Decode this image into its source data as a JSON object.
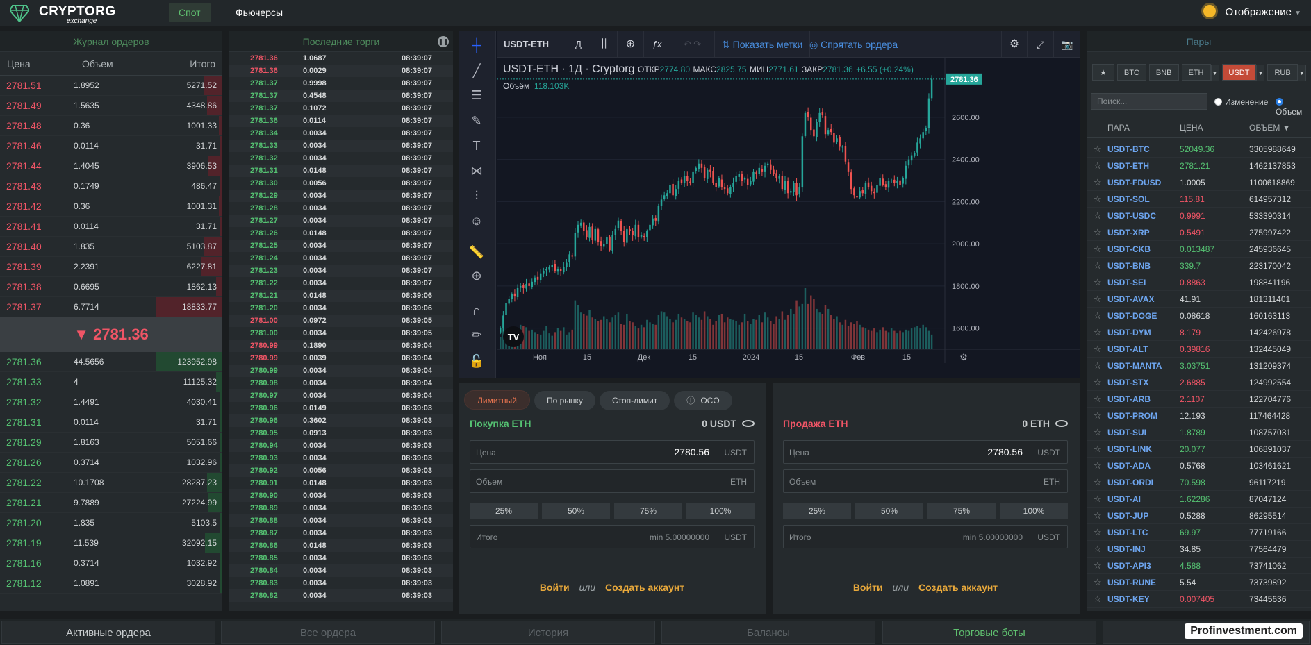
{
  "brand": {
    "name": "CRYPTORG",
    "sub": "exchange"
  },
  "nav": {
    "spot": "Спот",
    "futures": "Фьючерсы",
    "display": "Отображение"
  },
  "orderbook": {
    "title": "Журнал ордеров",
    "cols": [
      "Цена",
      "Объем",
      "Итого"
    ],
    "asks": [
      [
        "2781.51",
        "1.8952",
        "5271.52"
      ],
      [
        "2781.49",
        "1.5635",
        "4348.86"
      ],
      [
        "2781.48",
        "0.36",
        "1001.33"
      ],
      [
        "2781.46",
        "0.0114",
        "31.71"
      ],
      [
        "2781.44",
        "1.4045",
        "3906.53"
      ],
      [
        "2781.43",
        "0.1749",
        "486.47"
      ],
      [
        "2781.42",
        "0.36",
        "1001.31"
      ],
      [
        "2781.41",
        "0.0114",
        "31.71"
      ],
      [
        "2781.40",
        "1.835",
        "5103.87"
      ],
      [
        "2781.39",
        "2.2391",
        "6227.81"
      ],
      [
        "2781.38",
        "0.6695",
        "1862.13"
      ],
      [
        "2781.37",
        "6.7714",
        "18833.77"
      ]
    ],
    "mid": "▼ 2781.36",
    "bids": [
      [
        "2781.36",
        "44.5656",
        "123952.98"
      ],
      [
        "2781.33",
        "4",
        "11125.32"
      ],
      [
        "2781.32",
        "1.4491",
        "4030.41"
      ],
      [
        "2781.31",
        "0.0114",
        "31.71"
      ],
      [
        "2781.29",
        "1.8163",
        "5051.66"
      ],
      [
        "2781.26",
        "0.3714",
        "1032.96"
      ],
      [
        "2781.22",
        "10.1708",
        "28287.23"
      ],
      [
        "2781.21",
        "9.7889",
        "27224.99"
      ],
      [
        "2781.20",
        "1.835",
        "5103.5"
      ],
      [
        "2781.19",
        "11.539",
        "32092.15"
      ],
      [
        "2781.16",
        "0.3714",
        "1032.92"
      ],
      [
        "2781.12",
        "1.0891",
        "3028.92"
      ]
    ]
  },
  "trades": {
    "title": "Последние торги",
    "rows": [
      [
        "2781.36",
        "1.0687",
        "08:39:07",
        "r"
      ],
      [
        "2781.36",
        "0.0029",
        "08:39:07",
        "r"
      ],
      [
        "2781.37",
        "0.9998",
        "08:39:07",
        "g"
      ],
      [
        "2781.37",
        "0.4548",
        "08:39:07",
        "g"
      ],
      [
        "2781.37",
        "0.1072",
        "08:39:07",
        "g"
      ],
      [
        "2781.36",
        "0.0114",
        "08:39:07",
        "g"
      ],
      [
        "2781.34",
        "0.0034",
        "08:39:07",
        "g"
      ],
      [
        "2781.33",
        "0.0034",
        "08:39:07",
        "g"
      ],
      [
        "2781.32",
        "0.0034",
        "08:39:07",
        "g"
      ],
      [
        "2781.31",
        "0.0148",
        "08:39:07",
        "g"
      ],
      [
        "2781.30",
        "0.0056",
        "08:39:07",
        "g"
      ],
      [
        "2781.29",
        "0.0034",
        "08:39:07",
        "g"
      ],
      [
        "2781.28",
        "0.0034",
        "08:39:07",
        "g"
      ],
      [
        "2781.27",
        "0.0034",
        "08:39:07",
        "g"
      ],
      [
        "2781.26",
        "0.0148",
        "08:39:07",
        "g"
      ],
      [
        "2781.25",
        "0.0034",
        "08:39:07",
        "g"
      ],
      [
        "2781.24",
        "0.0034",
        "08:39:07",
        "g"
      ],
      [
        "2781.23",
        "0.0034",
        "08:39:07",
        "g"
      ],
      [
        "2781.22",
        "0.0034",
        "08:39:07",
        "g"
      ],
      [
        "2781.21",
        "0.0148",
        "08:39:06",
        "g"
      ],
      [
        "2781.20",
        "0.0034",
        "08:39:06",
        "g"
      ],
      [
        "2781.00",
        "0.0972",
        "08:39:05",
        "r"
      ],
      [
        "2781.00",
        "0.0034",
        "08:39:05",
        "g"
      ],
      [
        "2780.99",
        "0.1890",
        "08:39:04",
        "r"
      ],
      [
        "2780.99",
        "0.0039",
        "08:39:04",
        "r"
      ],
      [
        "2780.99",
        "0.0034",
        "08:39:04",
        "g"
      ],
      [
        "2780.98",
        "0.0034",
        "08:39:04",
        "g"
      ],
      [
        "2780.97",
        "0.0034",
        "08:39:04",
        "g"
      ],
      [
        "2780.96",
        "0.0149",
        "08:39:03",
        "g"
      ],
      [
        "2780.96",
        "0.3602",
        "08:39:03",
        "g"
      ],
      [
        "2780.95",
        "0.0913",
        "08:39:03",
        "g"
      ],
      [
        "2780.94",
        "0.0034",
        "08:39:03",
        "g"
      ],
      [
        "2780.93",
        "0.0034",
        "08:39:03",
        "g"
      ],
      [
        "2780.92",
        "0.0056",
        "08:39:03",
        "g"
      ],
      [
        "2780.91",
        "0.0148",
        "08:39:03",
        "g"
      ],
      [
        "2780.90",
        "0.0034",
        "08:39:03",
        "g"
      ],
      [
        "2780.89",
        "0.0034",
        "08:39:03",
        "g"
      ],
      [
        "2780.88",
        "0.0034",
        "08:39:03",
        "g"
      ],
      [
        "2780.87",
        "0.0034",
        "08:39:03",
        "g"
      ],
      [
        "2780.86",
        "0.0148",
        "08:39:03",
        "g"
      ],
      [
        "2780.85",
        "0.0034",
        "08:39:03",
        "g"
      ],
      [
        "2780.84",
        "0.0034",
        "08:39:03",
        "g"
      ],
      [
        "2780.83",
        "0.0034",
        "08:39:03",
        "g"
      ],
      [
        "2780.82",
        "0.0034",
        "08:39:03",
        "g"
      ]
    ]
  },
  "chart": {
    "symbol": "USDT-ETH",
    "interval": "Д",
    "show_marks": "Показать метки",
    "hide_orders": "Спрятать ордера",
    "legend": {
      "name": "USDT-ETH · 1Д · Cryptorg",
      "open_l": "ОТКР",
      "open": "2774.80",
      "high_l": "МАКС",
      "high": "2825.75",
      "low_l": "МИН",
      "low": "2771.61",
      "close_l": "ЗАКР",
      "close": "2781.36",
      "change": "+6.55 (+0.24%)",
      "vol_l": "Объём",
      "vol": "118.103K"
    },
    "price_tag": "2781.36",
    "y_ticks": [
      "2600.00",
      "2400.00",
      "2200.00",
      "2000.00",
      "1800.00",
      "1600.00"
    ],
    "x_ticks": [
      "Ноя",
      "15",
      "Дек",
      "15",
      "2024",
      "15",
      "Фев",
      "15"
    ]
  },
  "chart_data": {
    "type": "candlestick",
    "ylim": [
      1500,
      2850
    ],
    "close": [
      1600,
      1660,
      1720,
      1740,
      1760,
      1750,
      1790,
      1800,
      1790,
      1810,
      1800,
      1820,
      1840,
      1830,
      1860,
      1870,
      1880,
      1890,
      1900,
      1870,
      1880,
      1870,
      1890,
      1910,
      1950,
      1940,
      2050,
      2090,
      2100,
      2060,
      2030,
      2080,
      2020,
      2070,
      2010,
      1990,
      2000,
      2030,
      1970,
      2040,
      2070,
      2110,
      2060,
      2010,
      2070,
      2060,
      2040,
      2090,
      2030,
      2040,
      2030,
      2060,
      2090,
      2120,
      2110,
      2180,
      2210,
      2230,
      2240,
      2280,
      2230,
      2260,
      2300,
      2290,
      2320,
      2300,
      2290,
      2340,
      2360,
      2380,
      2360,
      2310,
      2350,
      2340,
      2290,
      2270,
      2310,
      2270,
      2260,
      2240,
      2270,
      2290,
      2320,
      2330,
      2300,
      2310,
      2280,
      2300,
      2340,
      2330,
      2360,
      2340,
      2370,
      2380,
      2350,
      2330,
      2310,
      2320,
      2260,
      2300,
      2240,
      2250,
      2290,
      2230,
      2270,
      2510,
      2620,
      2600,
      2540,
      2510,
      2580,
      2620,
      2610,
      2520,
      2540,
      2530,
      2480,
      2500,
      2460,
      2460,
      2390,
      2340,
      2260,
      2230,
      2220,
      2250,
      2240,
      2290,
      2270,
      2250,
      2240,
      2280,
      2310,
      2280,
      2270,
      2300,
      2300,
      2290,
      2300,
      2280,
      2310,
      2370,
      2400,
      2420,
      2430,
      2480,
      2500,
      2530,
      2550,
      2690,
      2780
    ],
    "volumes": [
      20,
      35,
      30,
      28,
      25,
      22,
      34,
      40,
      38,
      36,
      30,
      32,
      28,
      25,
      24,
      30,
      38,
      26,
      22,
      28,
      35,
      30,
      36,
      24,
      28,
      32,
      80,
      72,
      60,
      58,
      55,
      64,
      52,
      50,
      46,
      48,
      54,
      50,
      44,
      52,
      56,
      60,
      42,
      40,
      58,
      46,
      44,
      38,
      34,
      40,
      36,
      48,
      44,
      42,
      40,
      56,
      62,
      60,
      54,
      50,
      44,
      48,
      58,
      52,
      50,
      46,
      44,
      60,
      56,
      52,
      48,
      62,
      54,
      50,
      40,
      46,
      56,
      58,
      44,
      52,
      50,
      48,
      46,
      40,
      44,
      58,
      46,
      42,
      50,
      48,
      56,
      44,
      60,
      52,
      46,
      42,
      54,
      50,
      62,
      48,
      56,
      66,
      58,
      80,
      70,
      74,
      100,
      74,
      88,
      82,
      66,
      60,
      58,
      72,
      66,
      56,
      50,
      54,
      44,
      40,
      48,
      38,
      44,
      42,
      46,
      40,
      36,
      34,
      32,
      30,
      34,
      28,
      32,
      36,
      30,
      28,
      34,
      30,
      26,
      30,
      28,
      32,
      30,
      34,
      36,
      38,
      34,
      40,
      36,
      30,
      24
    ]
  },
  "form": {
    "tabs": [
      "Лимитный",
      "По рынку",
      "Стоп-лимит",
      "OCO"
    ],
    "buy": {
      "title": "Покупка ETH",
      "balance": "0 USDT",
      "price_l": "Цена",
      "price": "2780.56",
      "price_u": "USDT",
      "amount_l": "Объем",
      "amount_u": "ETH",
      "pcts": [
        "25%",
        "50%",
        "75%",
        "100%"
      ],
      "total_l": "Итого",
      "total_min": "min 5.00000000",
      "total_u": "USDT"
    },
    "sell": {
      "title": "Продажа ETH",
      "balance": "0 ETH",
      "price_l": "Цена",
      "price": "2780.56",
      "price_u": "USDT",
      "amount_l": "Объем",
      "amount_u": "ETH",
      "pcts": [
        "25%",
        "50%",
        "75%",
        "100%"
      ],
      "total_l": "Итого",
      "total_min": "min 5.00000000",
      "total_u": "USDT"
    },
    "login": "Войти",
    "or": "или",
    "register": "Создать аккаунт"
  },
  "pairs": {
    "title": "Пары",
    "tabs": [
      "BTC",
      "BNB",
      "ETH",
      "USDT",
      "RUB"
    ],
    "search": "Поиск...",
    "r_change": "Изменение",
    "r_volume": "Объем",
    "cols": [
      "ПАРА",
      "ЦЕНА",
      "ОБЪЕМ ▼"
    ],
    "rows": [
      [
        "USDT-BTC",
        "52049.36",
        "3305988649",
        "g"
      ],
      [
        "USDT-ETH",
        "2781.21",
        "1462137853",
        "g"
      ],
      [
        "USDT-FDUSD",
        "1.0005",
        "1100618869",
        "w"
      ],
      [
        "USDT-SOL",
        "115.81",
        "614957312",
        "r"
      ],
      [
        "USDT-USDC",
        "0.9991",
        "533390314",
        "r"
      ],
      [
        "USDT-XRP",
        "0.5491",
        "275997422",
        "r"
      ],
      [
        "USDT-CKB",
        "0.013487",
        "245936645",
        "g"
      ],
      [
        "USDT-BNB",
        "339.7",
        "223170042",
        "g"
      ],
      [
        "USDT-SEI",
        "0.8863",
        "198841196",
        "r"
      ],
      [
        "USDT-AVAX",
        "41.91",
        "181311401",
        "w"
      ],
      [
        "USDT-DOGE",
        "0.08618",
        "160163113",
        "w"
      ],
      [
        "USDT-DYM",
        "8.179",
        "142426978",
        "r"
      ],
      [
        "USDT-ALT",
        "0.39816",
        "132445049",
        "r"
      ],
      [
        "USDT-MANTA",
        "3.03751",
        "131209374",
        "g"
      ],
      [
        "USDT-STX",
        "2.6885",
        "124992554",
        "r"
      ],
      [
        "USDT-ARB",
        "2.1107",
        "122704776",
        "r"
      ],
      [
        "USDT-PROM",
        "12.193",
        "117464428",
        "w"
      ],
      [
        "USDT-SUI",
        "1.8789",
        "108757031",
        "g"
      ],
      [
        "USDT-LINK",
        "20.077",
        "106891037",
        "g"
      ],
      [
        "USDT-ADA",
        "0.5768",
        "103461621",
        "w"
      ],
      [
        "USDT-ORDI",
        "70.598",
        "96117219",
        "g"
      ],
      [
        "USDT-AI",
        "1.62286",
        "87047124",
        "g"
      ],
      [
        "USDT-JUP",
        "0.5288",
        "86295514",
        "w"
      ],
      [
        "USDT-LTC",
        "69.97",
        "77719166",
        "g"
      ],
      [
        "USDT-INJ",
        "34.85",
        "77564479",
        "w"
      ],
      [
        "USDT-API3",
        "4.588",
        "73741062",
        "g"
      ],
      [
        "USDT-RUNE",
        "5.54",
        "73739892",
        "w"
      ],
      [
        "USDT-KEY",
        "0.007405",
        "73445636",
        "r"
      ]
    ]
  },
  "bottom": {
    "tabs": [
      "Активные ордера",
      "Все ордера",
      "История",
      "Балансы",
      "Торговые боты"
    ],
    "watermark": "Profinvestment.com"
  }
}
